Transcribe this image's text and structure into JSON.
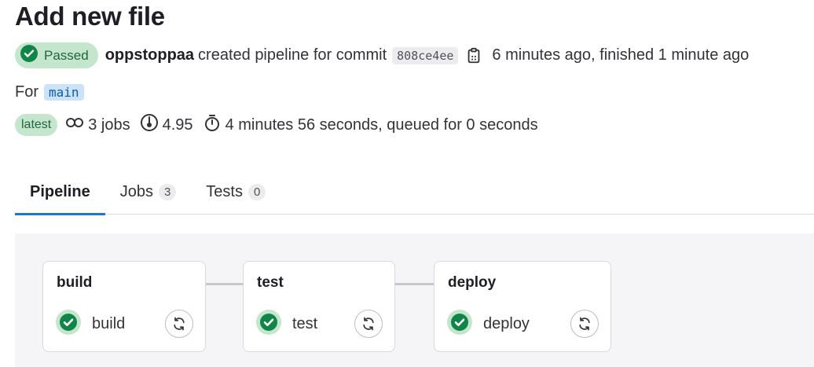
{
  "page": {
    "title": "Add new file"
  },
  "pipeline": {
    "status": "Passed",
    "author": "oppstoppaa",
    "created_text": "created pipeline for commit",
    "commit_sha": "808ce4ee",
    "time_text": "6 minutes ago, finished 1 minute ago",
    "ref_prefix": "For",
    "ref": "main",
    "latest_label": "latest",
    "jobs_count": "3 jobs",
    "compute": "4.95",
    "duration": "4 minutes 56 seconds, queued for 0 seconds"
  },
  "tabs": [
    {
      "label": "Pipeline",
      "count": null,
      "active": true
    },
    {
      "label": "Jobs",
      "count": "3",
      "active": false
    },
    {
      "label": "Tests",
      "count": "0",
      "active": false
    }
  ],
  "stages": [
    {
      "name": "build",
      "jobs": [
        {
          "name": "build",
          "status": "success"
        }
      ]
    },
    {
      "name": "test",
      "jobs": [
        {
          "name": "test",
          "status": "success"
        }
      ]
    },
    {
      "name": "deploy",
      "jobs": [
        {
          "name": "deploy",
          "status": "success"
        }
      ]
    }
  ],
  "icons": {
    "status": "check-circle-icon",
    "copy": "copy-icon",
    "jobs": "pipeline-link-icon",
    "compute": "gauge-icon",
    "duration": "stopwatch-icon",
    "retry": "retry-icon"
  },
  "colors": {
    "success": "#108548",
    "success_bg": "#c3e6cd",
    "branch_bg": "#cbe2f9",
    "tab_accent": "#1f75cb"
  }
}
